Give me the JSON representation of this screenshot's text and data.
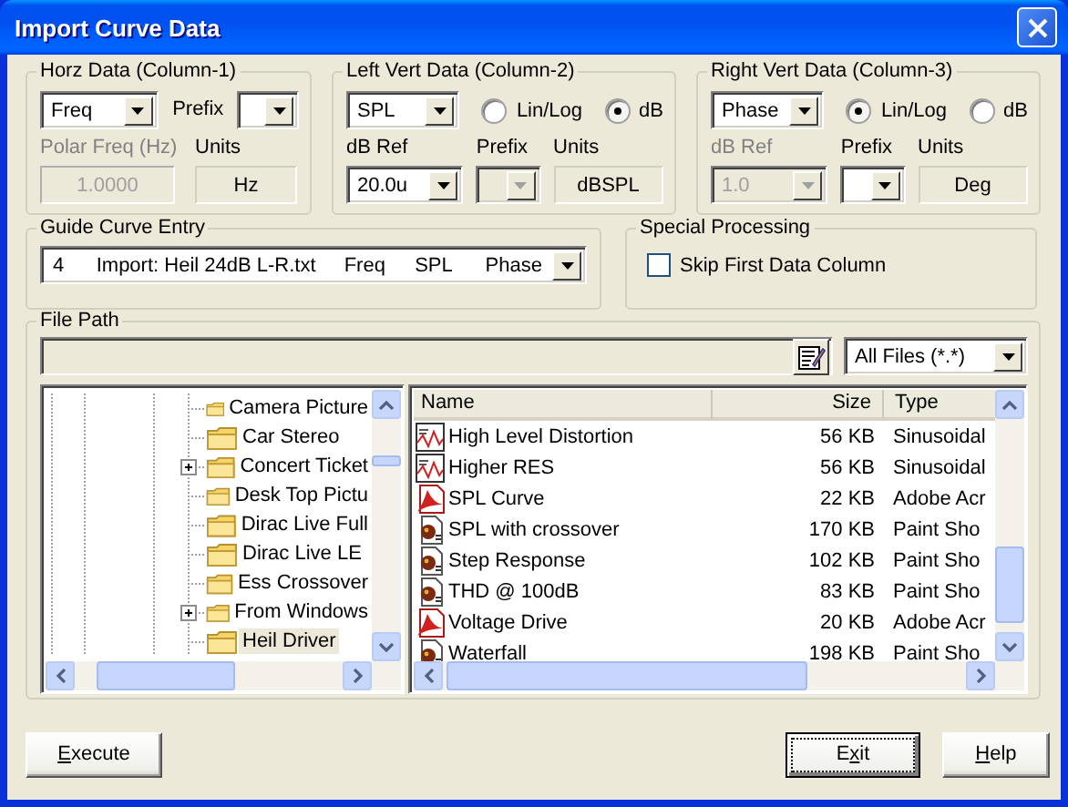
{
  "window": {
    "title": "Import Curve Data"
  },
  "groups": [
    {
      "title": "Horz Data (Column-1)",
      "quantity": {
        "value": "Freq"
      },
      "top_prefix": {
        "label": "Prefix"
      },
      "ref": {
        "label": "Polar Freq (Hz)",
        "kind": "text",
        "value": "1.0000",
        "disabled": true
      },
      "units": {
        "label": "Units",
        "value": "Hz"
      }
    },
    {
      "title": "Left Vert Data (Column-2)",
      "quantity": {
        "value": "SPL"
      },
      "scale_options": [
        {
          "label": "Lin/Log",
          "selected": false
        },
        {
          "label": "dB",
          "selected": true
        }
      ],
      "ref": {
        "label": "dB Ref",
        "kind": "select",
        "value": "20.0u",
        "disabled": false
      },
      "prefix": {
        "label": "Prefix",
        "disabled": true
      },
      "units": {
        "label": "Units",
        "value": "dBSPL"
      }
    },
    {
      "title": "Right Vert Data (Column-3)",
      "quantity": {
        "value": "Phase"
      },
      "scale_options": [
        {
          "label": "Lin/Log",
          "selected": true
        },
        {
          "label": "dB",
          "selected": false
        }
      ],
      "ref": {
        "label": "dB Ref",
        "kind": "select",
        "value": "1.0",
        "disabled": true
      },
      "prefix": {
        "label": "Prefix",
        "disabled": false
      },
      "units": {
        "label": "Units",
        "value": "Deg"
      }
    }
  ],
  "guide_curve": {
    "title": "Guide Curve Entry",
    "cells": [
      "4",
      "Import: Heil 24dB L-R.txt",
      "Freq",
      "SPL",
      "Phase"
    ]
  },
  "special": {
    "title": "Special Processing",
    "checkbox": {
      "label": "Skip First Data Column",
      "checked": false
    }
  },
  "file_path": {
    "title": "File Path",
    "filter": "All Files (*.*)"
  },
  "tree": [
    {
      "label": "Camera Picture",
      "expandable": false,
      "selected": false
    },
    {
      "label": "Car Stereo",
      "expandable": false,
      "selected": false
    },
    {
      "label": "Concert Ticket",
      "expandable": true,
      "selected": false
    },
    {
      "label": "Desk Top Pictu",
      "expandable": false,
      "selected": false
    },
    {
      "label": "Dirac Live Full",
      "expandable": false,
      "selected": false
    },
    {
      "label": "Dirac Live LE",
      "expandable": false,
      "selected": false
    },
    {
      "label": "Ess Crossover",
      "expandable": false,
      "selected": false
    },
    {
      "label": "From Windows",
      "expandable": true,
      "selected": false
    },
    {
      "label": "Heil Driver",
      "expandable": false,
      "selected": true
    }
  ],
  "files": {
    "columns": [
      "Name",
      "Size",
      "Type"
    ],
    "rows": [
      {
        "kind": "sinusoidal",
        "name": "High Level Distortion",
        "size": "56 KB",
        "type": "Sinusoidal"
      },
      {
        "kind": "sinusoidal",
        "name": "Higher RES",
        "size": "56 KB",
        "type": "Sinusoidal"
      },
      {
        "kind": "pdf",
        "name": "SPL Curve",
        "size": "22 KB",
        "type": "Adobe Acr"
      },
      {
        "kind": "paint",
        "name": "SPL with crossover",
        "size": "170 KB",
        "type": "Paint Sho"
      },
      {
        "kind": "paint",
        "name": "Step Response",
        "size": "102 KB",
        "type": "Paint Sho"
      },
      {
        "kind": "paint",
        "name": "THD @ 100dB",
        "size": "83 KB",
        "type": "Paint Sho"
      },
      {
        "kind": "pdf",
        "name": "Voltage Drive",
        "size": "20 KB",
        "type": "Adobe Acr"
      },
      {
        "kind": "paint",
        "name": "Waterfall",
        "size": "198 KB",
        "type": "Paint Sho"
      }
    ]
  },
  "buttons": [
    {
      "label_parts": [
        {
          "text": "E",
          "underline": true
        },
        {
          "text": "xecute",
          "underline": false
        }
      ],
      "default": false
    },
    {
      "label_parts": [
        {
          "text": "E",
          "underline": false
        },
        {
          "text": "x",
          "underline": true
        },
        {
          "text": "it",
          "underline": false
        }
      ],
      "default": true
    },
    {
      "label_parts": [
        {
          "text": "H",
          "underline": true
        },
        {
          "text": "elp",
          "underline": false
        }
      ],
      "default": false
    }
  ]
}
